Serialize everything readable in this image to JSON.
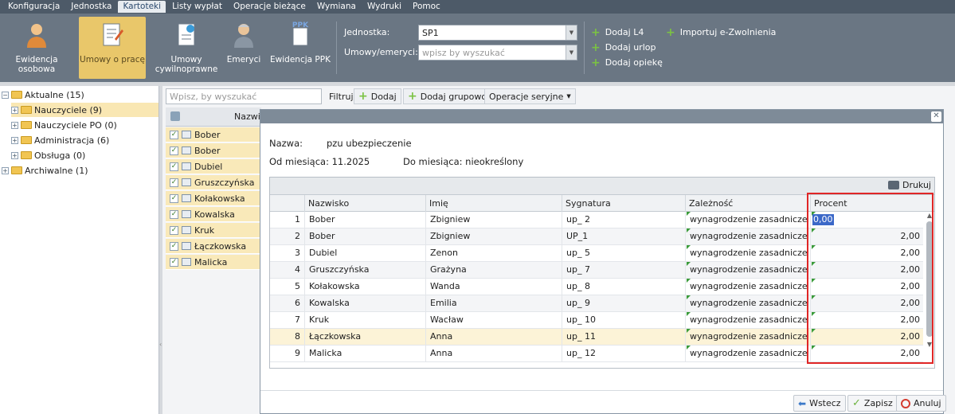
{
  "menu": [
    "Konfiguracja",
    "Jednostka",
    "Kartoteki",
    "Listy wypłat",
    "Operacje bieżące",
    "Wymiana",
    "Wydruki",
    "Pomoc"
  ],
  "ribbon": {
    "buttons": [
      {
        "label": "Ewidencja\nosobowa",
        "icon": "person-icon"
      },
      {
        "label": "Umowy o pracę",
        "icon": "contract-icon"
      },
      {
        "label": "Umowy\ncywilnoprawne",
        "icon": "document-icon"
      },
      {
        "label": "Emeryci",
        "icon": "retiree-icon"
      },
      {
        "label": "Ewidencja PPK",
        "icon": "ppk-icon",
        "badge": "PPK"
      }
    ],
    "jednostka_label": "Jednostka:",
    "jednostka_value": "SP1",
    "umowy_label": "Umowy/emeryci:",
    "umowy_placeholder": "wpisz by wyszukać",
    "actions": [
      "Dodaj L4",
      "Dodaj urlop",
      "Dodaj opiekę",
      "Importuj e-Zwolnienia"
    ]
  },
  "tree": [
    {
      "label": "Aktualne (15)",
      "expanded": true
    },
    {
      "label": "Nauczyciele (9)",
      "selected": true
    },
    {
      "label": "Nauczyciele PO (0)"
    },
    {
      "label": "Administracja (6)"
    },
    {
      "label": "Obsługa (0)"
    },
    {
      "label": "Archiwalne (1)"
    }
  ],
  "middle": {
    "search_placeholder": "Wpisz, by wyszukać",
    "filter_label": "Filtruj",
    "add_label": "Dodaj",
    "add_group_label": "Dodaj grupowo",
    "bulk_label": "Operacje seryjne",
    "header_col": "Nazwi",
    "rows": [
      "Bober",
      "Bober",
      "Dubiel",
      "Gruszczyńska",
      "Kołakowska",
      "Kowalska",
      "Kruk",
      "Łączkowska",
      "Malicka"
    ]
  },
  "modal": {
    "nazwa_label": "Nazwa:",
    "nazwa_value": "pzu ubezpieczenie",
    "od_label": "Od miesiąca: 11.2025",
    "do_label": "Do miesiąca: nieokreślony",
    "print_label": "Drukuj",
    "columns": [
      "Nazwisko",
      "Imię",
      "Sygnatura",
      "Zależność",
      "Procent"
    ],
    "rows": [
      {
        "n": "1",
        "nazwisko": "Bober",
        "imie": "Zbigniew",
        "sygnatura": "up_ 2",
        "zaleznosc": "wynagrodzenie zasadnicze b...",
        "procent": "0,00"
      },
      {
        "n": "2",
        "nazwisko": "Bober",
        "imie": "Zbigniew",
        "sygnatura": "UP_1",
        "zaleznosc": "wynagrodzenie zasadnicze b...",
        "procent": "2,00"
      },
      {
        "n": "3",
        "nazwisko": "Dubiel",
        "imie": "Zenon",
        "sygnatura": "up_ 5",
        "zaleznosc": "wynagrodzenie zasadnicze b...",
        "procent": "2,00"
      },
      {
        "n": "4",
        "nazwisko": "Gruszczyńska",
        "imie": "Grażyna",
        "sygnatura": "up_ 7",
        "zaleznosc": "wynagrodzenie zasadnicze b...",
        "procent": "2,00"
      },
      {
        "n": "5",
        "nazwisko": "Kołakowska",
        "imie": "Wanda",
        "sygnatura": "up_ 8",
        "zaleznosc": "wynagrodzenie zasadnicze b...",
        "procent": "2,00"
      },
      {
        "n": "6",
        "nazwisko": "Kowalska",
        "imie": "Emilia",
        "sygnatura": "up_ 9",
        "zaleznosc": "wynagrodzenie zasadnicze b...",
        "procent": "2,00"
      },
      {
        "n": "7",
        "nazwisko": "Kruk",
        "imie": "Wacław",
        "sygnatura": "up_ 10",
        "zaleznosc": "wynagrodzenie zasadnicze b...",
        "procent": "2,00"
      },
      {
        "n": "8",
        "nazwisko": "Łączkowska",
        "imie": "Anna",
        "sygnatura": "up_ 11",
        "zaleznosc": "wynagrodzenie zasadnicze b...",
        "procent": "2,00"
      },
      {
        "n": "9",
        "nazwisko": "Malicka",
        "imie": "Anna",
        "sygnatura": "up_ 12",
        "zaleznosc": "wynagrodzenie zasadnicze b...",
        "procent": "2,00"
      }
    ],
    "back_label": "Wstecz",
    "save_label": "Zapisz",
    "cancel_label": "Anuluj"
  },
  "colors": {
    "accent": "#e9c76a",
    "highlight": "#e02626",
    "selection": "#3b68c8"
  }
}
